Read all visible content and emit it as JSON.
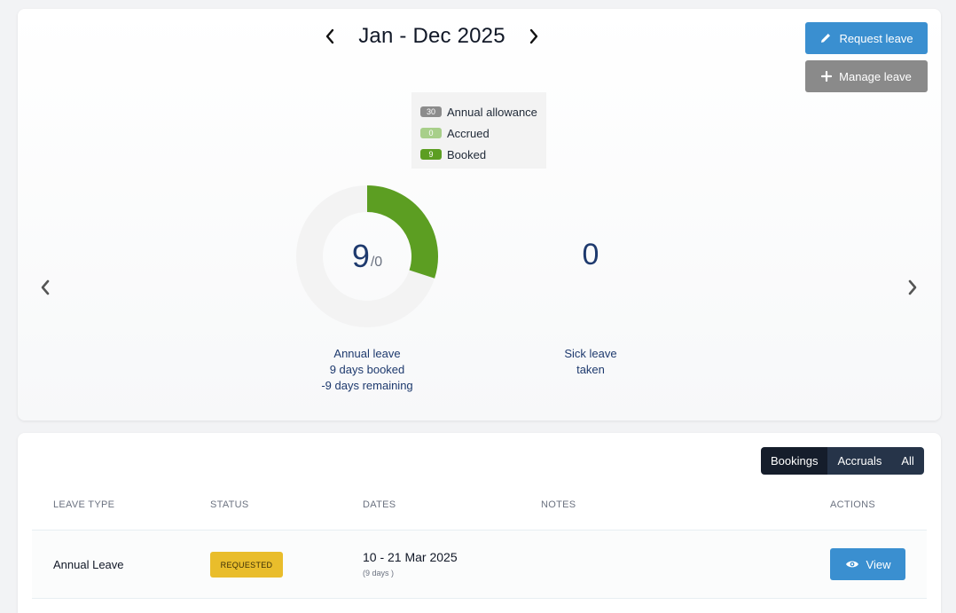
{
  "header": {
    "period_title": "Jan - Dec 2025",
    "request_leave_label": "Request leave",
    "manage_leave_label": "Manage leave"
  },
  "legend": {
    "items": [
      {
        "value": "30",
        "label": "Annual allowance",
        "color": "#8c8c8c"
      },
      {
        "value": "0",
        "label": "Accrued",
        "color": "#a8cf8a"
      },
      {
        "value": "9",
        "label": "Booked",
        "color": "#5c9e22"
      }
    ]
  },
  "annual": {
    "booked_value": "9",
    "denominator": "/0",
    "booked_days": 9,
    "allowance_days": 30,
    "caption_title": "Annual leave",
    "caption_booked": "9 days booked",
    "caption_remaining": "-9 days remaining",
    "ring_color": "#5c9e22",
    "track_color": "#f3f3f3"
  },
  "sick": {
    "value": "0",
    "caption_title": "Sick leave",
    "caption_sub": "taken"
  },
  "filters": {
    "tabs": [
      "Bookings",
      "Accruals",
      "All"
    ],
    "active": "Bookings"
  },
  "table": {
    "columns": [
      "LEAVE TYPE",
      "STATUS",
      "DATES",
      "NOTES",
      "ACTIONS"
    ],
    "rows": [
      {
        "leave_type": "Annual Leave",
        "status": "REQUESTED",
        "dates": "10 - 21 Mar 2025",
        "days": "(9 days )",
        "notes": "",
        "action_label": "View"
      }
    ]
  },
  "colors": {
    "primary": "#3a8fd0",
    "secondary": "#8a8a8a",
    "status_requested": "#e9bd2b",
    "navy_text": "#1e3a6e"
  }
}
